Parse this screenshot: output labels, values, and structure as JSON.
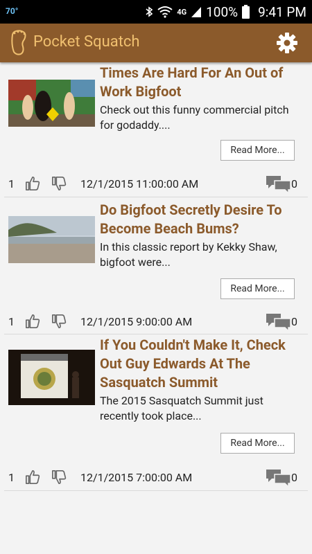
{
  "status": {
    "temperature": "70°",
    "network": "4G",
    "battery": "100%",
    "time": "9:41 PM"
  },
  "app": {
    "title": "Pocket Squatch"
  },
  "articles": [
    {
      "title": "Times Are Hard For An Out of Work Bigfoot",
      "summary": "Check out this funny commercial pitch for godaddy....",
      "read_more": "Read More...",
      "likes": "1",
      "date": "12/1/2015 11:00:00 AM",
      "comments": "0"
    },
    {
      "title": "Do Bigfoot Secretly Desire To Become Beach Bums?",
      "summary": "In this classic report by Kekky Shaw, bigfoot were...",
      "read_more": "Read More...",
      "likes": "1",
      "date": "12/1/2015 9:00:00 AM",
      "comments": "0"
    },
    {
      "title": "If You Couldn't Make It, Check Out Guy Edwards At The Sasquatch Summit",
      "summary": "The 2015 Sasquatch Summit just recently took place...",
      "read_more": "Read More...",
      "likes": "1",
      "date": "12/1/2015 7:00:00 AM",
      "comments": "0"
    }
  ]
}
